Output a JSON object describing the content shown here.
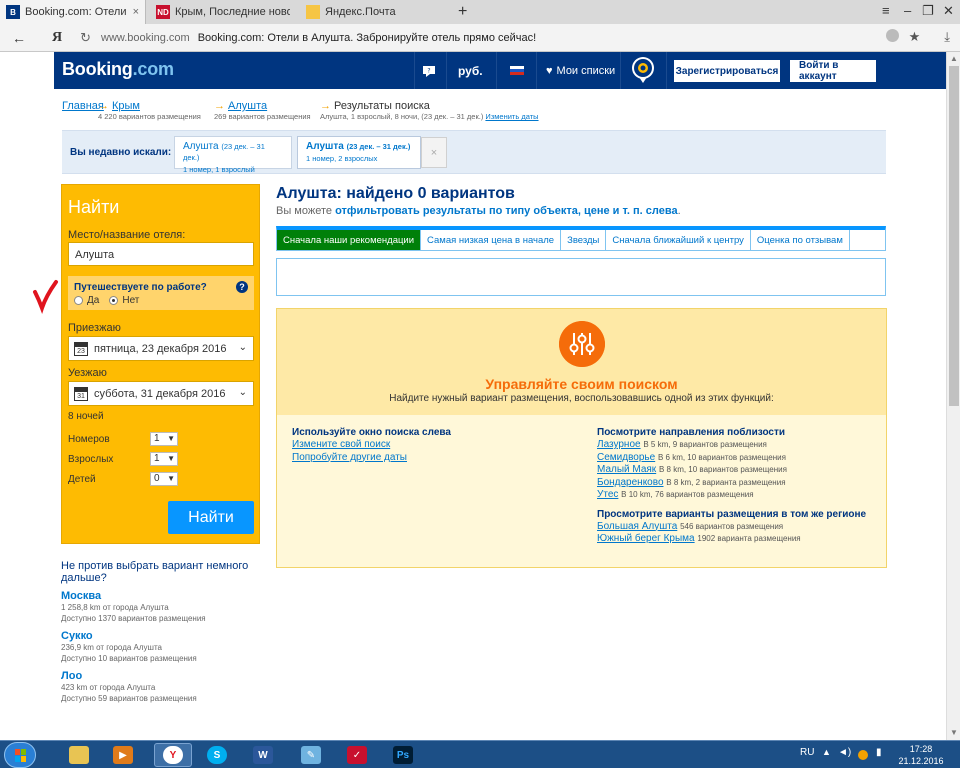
{
  "browser": {
    "tabs": [
      {
        "title": "Booking.com: Отели в Ал",
        "favicon": "B",
        "color": "#003580"
      },
      {
        "title": "Крым, Последние новости",
        "favicon": "ND",
        "color": "#c8102e"
      },
      {
        "title": "Яндекс.Почта",
        "favicon": "",
        "color": "#f6c544"
      }
    ],
    "new_tab": "+",
    "url_host": "www.booking.com",
    "url_title": "Booking.com: Отели в Алушта. Забронируйте отель прямо сейчас!",
    "yandex": "Я"
  },
  "header": {
    "logo_main": "Booking",
    "logo_suffix": ".com",
    "currency": "руб.",
    "my_lists": "Мои списки",
    "register": "Зарегистрироваться",
    "login": "Войти в аккаунт"
  },
  "breadcrumbs": [
    {
      "label": "Главная",
      "sub": ""
    },
    {
      "label": "Крым",
      "sub": "4 220 вариантов размещения"
    },
    {
      "label": "Алушта",
      "sub": "269 вариантов размещения"
    },
    {
      "label": "Результаты поиска",
      "sub": "Алушта, 1 взрослый, 8 ночи, (23 дек. – 31 дек.)",
      "link": "Изменить даты"
    }
  ],
  "recent": {
    "label": "Вы недавно искали:",
    "items": [
      {
        "city": "Алушта",
        "dates": "(23 дек. – 31 дек.)",
        "details": "1 номер, 1 взрослый"
      },
      {
        "city": "Алушта",
        "dates": "(23 дек. – 31 дек.)",
        "details": "1 номер, 2 взрослых"
      }
    ],
    "close": "×"
  },
  "search": {
    "title": "Найти",
    "place_label": "Место/название отеля:",
    "place_value": "Алушта",
    "business_q": "Путешествуете по работе?",
    "help": "?",
    "yes": "Да",
    "no": "Нет",
    "checkin_label": "Приезжаю",
    "checkin_value": "пятница, 23 декабря 2016",
    "checkout_label": "Уезжаю",
    "checkout_value": "суббота, 31 декабря 2016",
    "cal_in": "23",
    "cal_out": "31",
    "nights": "8 ночей",
    "rooms_label": "Номеров",
    "rooms": "1",
    "adults_label": "Взрослых",
    "adults": "1",
    "children_label": "Детей",
    "children": "0",
    "button": "Найти"
  },
  "nearby": {
    "question": "Не против выбрать вариант немного дальше?",
    "items": [
      {
        "city": "Москва",
        "dist": "1 258,8 km от города Алушта",
        "count": "Доступно 1370 вариантов размещения"
      },
      {
        "city": "Сукко",
        "dist": "236,9 km от города Алушта",
        "count": "Доступно 10 вариантов размещения"
      },
      {
        "city": "Лоо",
        "dist": "423 km от города Алушта",
        "count": "Доступно 59 вариантов размещения"
      }
    ]
  },
  "results": {
    "title": "Алушта: найдено 0 вариантов",
    "sub_prefix": "Вы можете",
    "sub_bold": "отфильтровать результаты по типу объекта, цене и т. п. слева",
    "sub_suffix": "."
  },
  "sort_tabs": [
    "Сначала наши рекомендации",
    "Самая низкая цена в начале",
    "Звезды",
    "Сначала ближайший к центру",
    "Оценка по отзывам"
  ],
  "manage": {
    "title": "Управляйте своим поиском",
    "subtitle": "Найдите нужный вариант размещения, воспользовавшись одной из этих функций:",
    "left_heading": "Используйте окно поиска слева",
    "left_links": [
      "Измените свой поиск",
      "Попробуйте другие даты"
    ],
    "right_heading": "Посмотрите направления поблизости",
    "nearby_links": [
      {
        "name": "Лазурное",
        "info": "В 5 km, 9 вариантов размещения"
      },
      {
        "name": "Семидворье",
        "info": "В 6 km, 10 вариантов размещения"
      },
      {
        "name": "Малый Маяк",
        "info": "В 8 km, 10 вариантов размещения"
      },
      {
        "name": "Бондаренково",
        "info": "В 8 km, 2 варианта размещения"
      },
      {
        "name": "Утес",
        "info": "В 10 km, 76 вариантов размещения"
      }
    ],
    "region_heading": "Просмотрите варианты размещения в том же регионе",
    "region_links": [
      {
        "name": "Большая Алушта",
        "info": "546 вариантов размещения"
      },
      {
        "name": "Южный берег Крыма",
        "info": "1902 варианта размещения"
      }
    ]
  },
  "taskbar": {
    "lang": "RU",
    "time": "17:28",
    "date": "21.12.2016"
  },
  "colors": {
    "brand": "#003580",
    "yellow": "#febb02",
    "button_blue": "#0896ff",
    "active_green": "#008009",
    "orange": "#f56c0a"
  }
}
